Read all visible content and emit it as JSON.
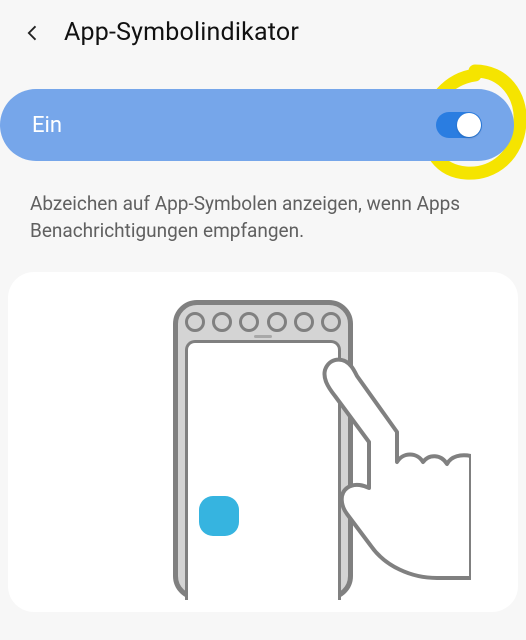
{
  "header": {
    "title": "App-Symbolindikator"
  },
  "toggle": {
    "label": "Ein",
    "on": true
  },
  "description": "Abzeichen auf App-Symbolen anzeigen, wenn Apps Benachrichtigungen empfangen.",
  "colors": {
    "accent": "#76a6ea",
    "switch": "#2a7de1",
    "annot": "#f5e400",
    "appIcon": "#36b4e0"
  }
}
